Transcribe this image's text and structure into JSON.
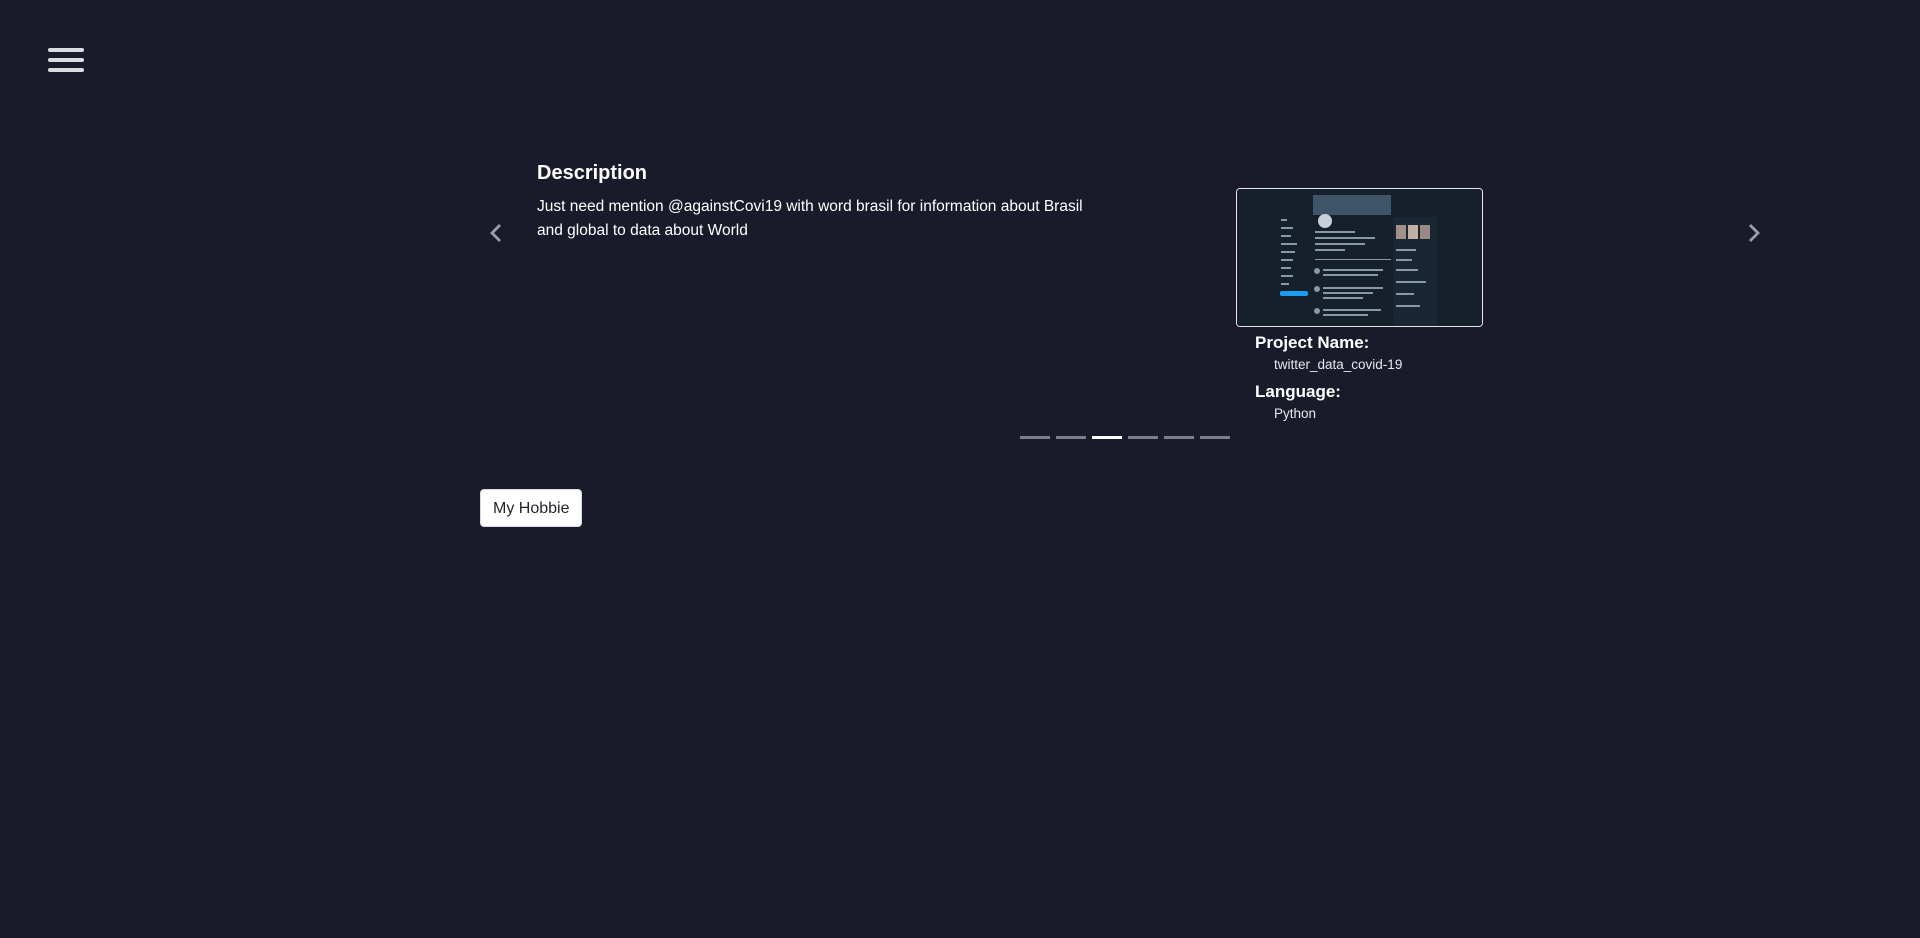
{
  "menu": {
    "icon": "hamburger-menu-icon"
  },
  "carousel": {
    "prev_icon": "chevron-left-icon",
    "next_icon": "chevron-right-icon",
    "slide": {
      "description_title": "Description",
      "description_text": "Just need mention @againstCovi19 with word brasil for information about Brasil and global to data about World",
      "project_name_label": "Project Name:",
      "project_name_value": "twitter_data_covid-19",
      "language_label": "Language:",
      "language_value": "Python"
    },
    "indicator_count": 6,
    "active_indicator": 3
  },
  "hobbie_button": {
    "label": "My Hobbie"
  },
  "colors": {
    "background": "#1a1b2a",
    "text": "#ffffff",
    "indicator": "#7d7f8a",
    "indicator_active": "#ffffff"
  }
}
